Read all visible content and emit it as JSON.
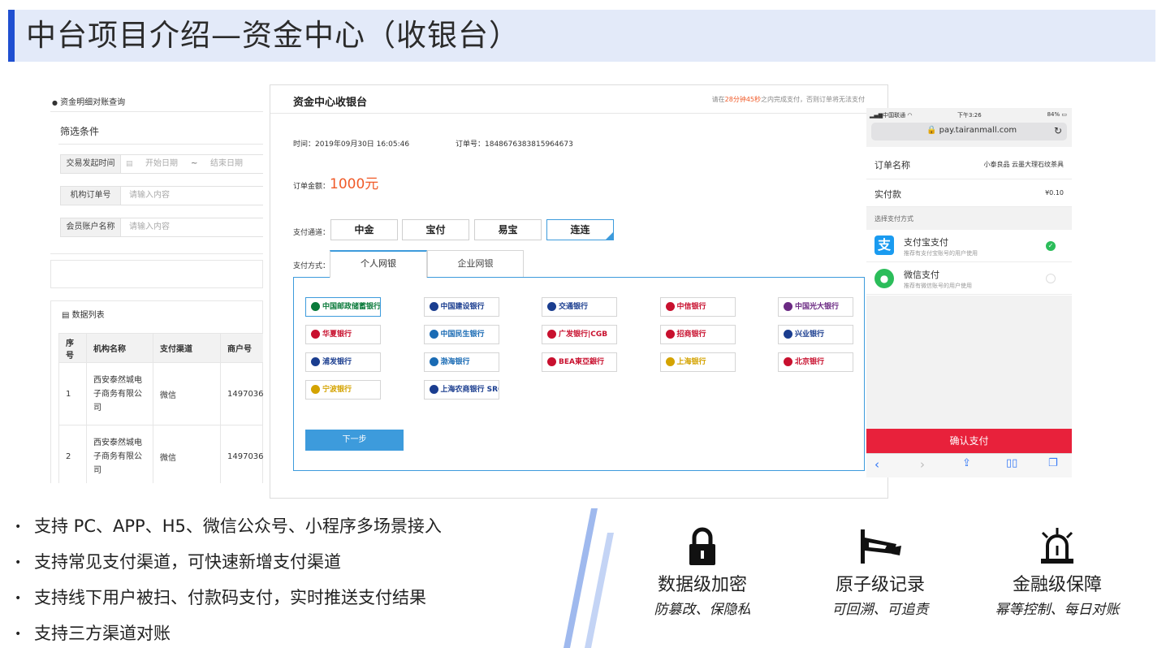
{
  "header": {
    "title": "中台项目介绍—资金中心（收银台）"
  },
  "left_panel": {
    "breadcrumb": "资金明细对账查询",
    "filter_title": "筛选条件",
    "fields": [
      {
        "label": "交易发起时间",
        "start_placeholder": "开始日期",
        "separator": "~",
        "end_placeholder": "结束日期"
      },
      {
        "label": "机构订单号",
        "placeholder": "请输入内容"
      },
      {
        "label": "会员账户名称",
        "placeholder": "请输入内容"
      }
    ],
    "list_title": "数据列表",
    "table": {
      "headers": [
        "序号",
        "机构名称",
        "支付渠道",
        "商户号"
      ],
      "rows": [
        {
          "no": "1",
          "org": "西安泰然城电子商务有限公司",
          "channel": "微信",
          "merchant": "1497036"
        },
        {
          "no": "2",
          "org": "西安泰然城电子商务有限公司",
          "channel": "微信",
          "merchant": "1497036"
        }
      ]
    }
  },
  "cashier": {
    "title": "资金中心收银台",
    "notice_prefix": "请在",
    "notice_time": "28分钟45秒",
    "notice_suffix": "之内完成支付，否则订单将无法支付",
    "time_label": "时间：2019年09月30日 16:05:46",
    "order_label": "订单号：1848676383815964673",
    "amount_label": "订单金额：",
    "amount_value": "1000元",
    "channel_label": "支付通道：",
    "channels": [
      "中金",
      "宝付",
      "易宝",
      "连连"
    ],
    "method_label": "支付方式：",
    "tabs": [
      "个人网银",
      "企业网银"
    ],
    "banks": [
      {
        "name": "中国邮政储蓄银行",
        "color": "#0a7a3a"
      },
      {
        "name": "中国建设银行",
        "color": "#1a3d8f"
      },
      {
        "name": "交通银行",
        "color": "#1a3d8f"
      },
      {
        "name": "中信银行",
        "color": "#c8102e"
      },
      {
        "name": "中国光大银行",
        "color": "#6b2a83"
      },
      {
        "name": "华夏银行",
        "color": "#c8102e"
      },
      {
        "name": "中国民生银行",
        "color": "#1a6bb4"
      },
      {
        "name": "广发银行|CGB",
        "color": "#c8102e"
      },
      {
        "name": "招商银行",
        "color": "#c8102e"
      },
      {
        "name": "兴业银行",
        "color": "#1a3d8f"
      },
      {
        "name": "浦发银行",
        "color": "#1a3d8f"
      },
      {
        "name": "渤海银行",
        "color": "#1a6bb4"
      },
      {
        "name": "BEA東亞銀行",
        "color": "#c8102e"
      },
      {
        "name": "上海银行",
        "color": "#d4a300"
      },
      {
        "name": "北京银行",
        "color": "#c8102e"
      },
      {
        "name": "宁波银行",
        "color": "#d4a300"
      },
      {
        "name": "上海农商银行 SRCB",
        "color": "#1a3d8f"
      }
    ],
    "next_button": "下一步",
    "accent": "#3d9bdc",
    "amount_color": "#f05a28"
  },
  "phone": {
    "carrier": "中国联通",
    "time": "下午3:26",
    "battery": "84%",
    "url": "pay.tairanmall.com",
    "order_name_label": "订单名称",
    "order_name_value": "小泰良品 云墨大理石纹茶具",
    "paid_label": "实付款",
    "paid_value": "¥0.10",
    "choose_label": "选择支付方式",
    "methods": [
      {
        "name": "支付宝支付",
        "desc": "推荐有支付宝账号的用户使用",
        "checked": true
      },
      {
        "name": "微信支付",
        "desc": "推荐有微信账号的用户使用",
        "checked": false
      }
    ],
    "confirm_button": "确认支付",
    "confirm_color": "#e8213b"
  },
  "bullets": [
    "支持 PC、APP、H5、微信公众号、小程序多场景接入",
    "支持常见支付渠道，可快速新增支付渠道",
    "支持线下用户被扫、付款码支付，实时推送支付结果",
    "支持三方渠道对账"
  ],
  "features": [
    {
      "icon": "lock-icon",
      "title": "数据级加密",
      "subtitle": "防篡改、保隐私"
    },
    {
      "icon": "camera-icon",
      "title": "原子级记录",
      "subtitle": "可回溯、可追责"
    },
    {
      "icon": "alarm-icon",
      "title": "金融级保障",
      "subtitle": "幂等控制、每日对账"
    }
  ]
}
